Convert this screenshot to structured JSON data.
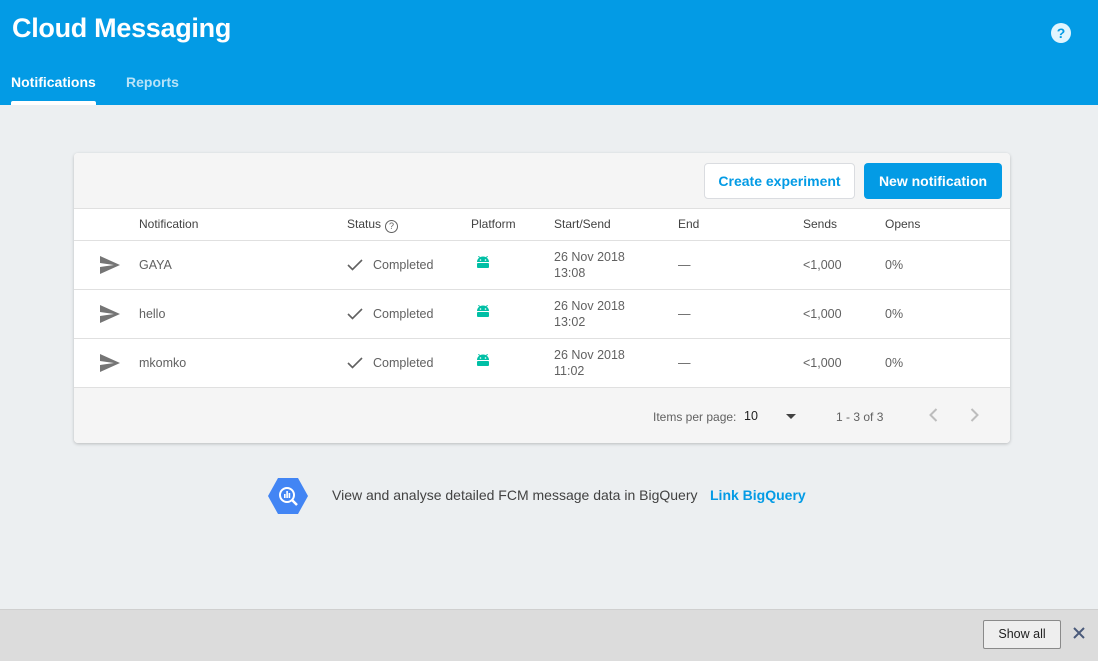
{
  "header": {
    "title": "Cloud Messaging",
    "help_icon": "help-circle-icon",
    "help_glyph": "?",
    "tabs": [
      {
        "label": "Notifications",
        "active": true
      },
      {
        "label": "Reports",
        "active": false
      }
    ]
  },
  "toolbar": {
    "create_experiment_label": "Create experiment",
    "new_notification_label": "New notification"
  },
  "table": {
    "columns": [
      "Notification",
      "Status",
      "Platform",
      "Start/Send",
      "End",
      "Sends",
      "Opens"
    ],
    "rows": [
      {
        "name": "GAYA",
        "status": "Completed",
        "platform": "android-icon",
        "start_date": "26 Nov 2018",
        "start_time": "13:08",
        "end": "—",
        "sends": "<1,000",
        "opens": "0%"
      },
      {
        "name": "hello",
        "status": "Completed",
        "platform": "android-icon",
        "start_date": "26 Nov 2018",
        "start_time": "13:02",
        "end": "—",
        "sends": "<1,000",
        "opens": "0%"
      },
      {
        "name": "mkomko",
        "status": "Completed",
        "platform": "android-icon",
        "start_date": "26 Nov 2018",
        "start_time": "11:02",
        "end": "—",
        "sends": "<1,000",
        "opens": "0%"
      }
    ]
  },
  "pagination": {
    "items_per_page_label": "Items per page:",
    "items_per_page_value": "10",
    "range_label": "1 - 3 of 3"
  },
  "bigquery": {
    "text": "View and analyse detailed FCM message data in BigQuery",
    "link_label": "Link BigQuery"
  },
  "bottom_bar": {
    "show_all_label": "Show all"
  },
  "colors": {
    "brand_blue": "#039be5",
    "android_green": "#00bfa5",
    "background": "#eceff1"
  }
}
